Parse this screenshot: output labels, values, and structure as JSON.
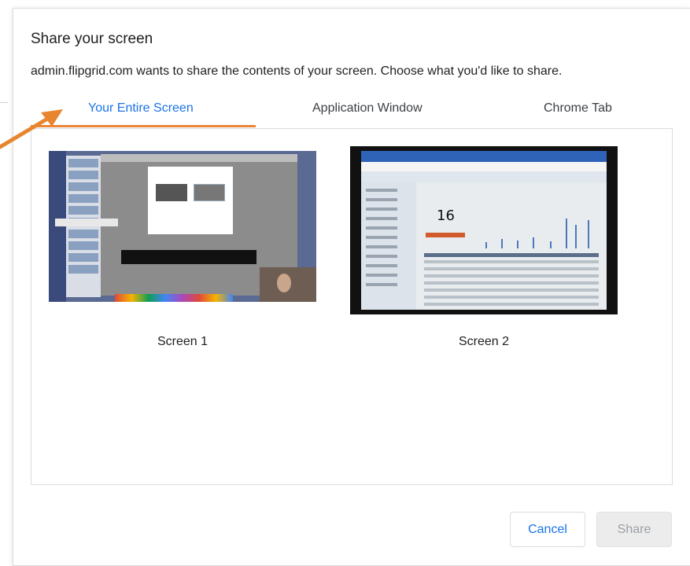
{
  "dialog": {
    "title": "Share your screen",
    "subtitle": "admin.flipgrid.com wants to share the contents of your screen. Choose what you'd like to share."
  },
  "tabs": [
    {
      "label": "Your Entire Screen",
      "active": true
    },
    {
      "label": "Application Window",
      "active": false
    },
    {
      "label": "Chrome Tab",
      "active": false
    }
  ],
  "screens": [
    {
      "label": "Screen 1"
    },
    {
      "label": "Screen 2",
      "preview_number": "16"
    }
  ],
  "buttons": {
    "cancel_label": "Cancel",
    "share_label": "Share"
  },
  "colors": {
    "accent": "#1a73e8",
    "tab_underline": "#e8863a",
    "annotation_arrow": "#e8862f"
  },
  "annotation": {
    "icon": "arrow-icon"
  }
}
